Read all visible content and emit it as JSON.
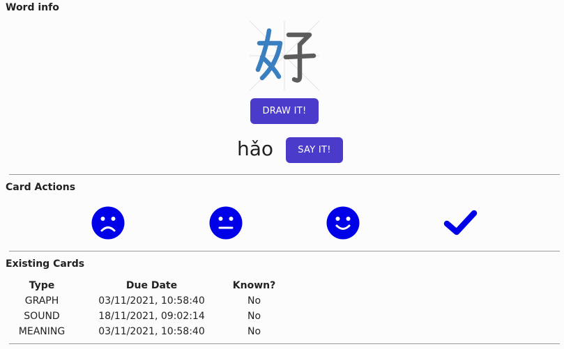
{
  "word_info": {
    "title": "Word info",
    "character": "好",
    "draw_button": "DRAW IT!",
    "pinyin": "hǎo",
    "say_button": "SAY IT!"
  },
  "card_actions": {
    "title": "Card Actions",
    "actions": [
      {
        "icon": "sad-face-icon"
      },
      {
        "icon": "neutral-face-icon"
      },
      {
        "icon": "happy-face-icon"
      },
      {
        "icon": "checkmark-icon"
      }
    ],
    "icon_color": "#0000e8"
  },
  "existing_cards": {
    "title": "Existing Cards",
    "columns": [
      "Type",
      "Due Date",
      "Known?"
    ],
    "rows": [
      {
        "type": "GRAPH",
        "due": "03/11/2021, 10:58:40",
        "known": "No"
      },
      {
        "type": "SOUND",
        "due": "18/11/2021, 09:02:14",
        "known": "No"
      },
      {
        "type": "MEANING",
        "due": "03/11/2021, 10:58:40",
        "known": "No"
      }
    ]
  },
  "colors": {
    "button": "#4b3bcb",
    "radical_highlight": "#3a7fc0",
    "character_rest": "#5c5c5c"
  }
}
